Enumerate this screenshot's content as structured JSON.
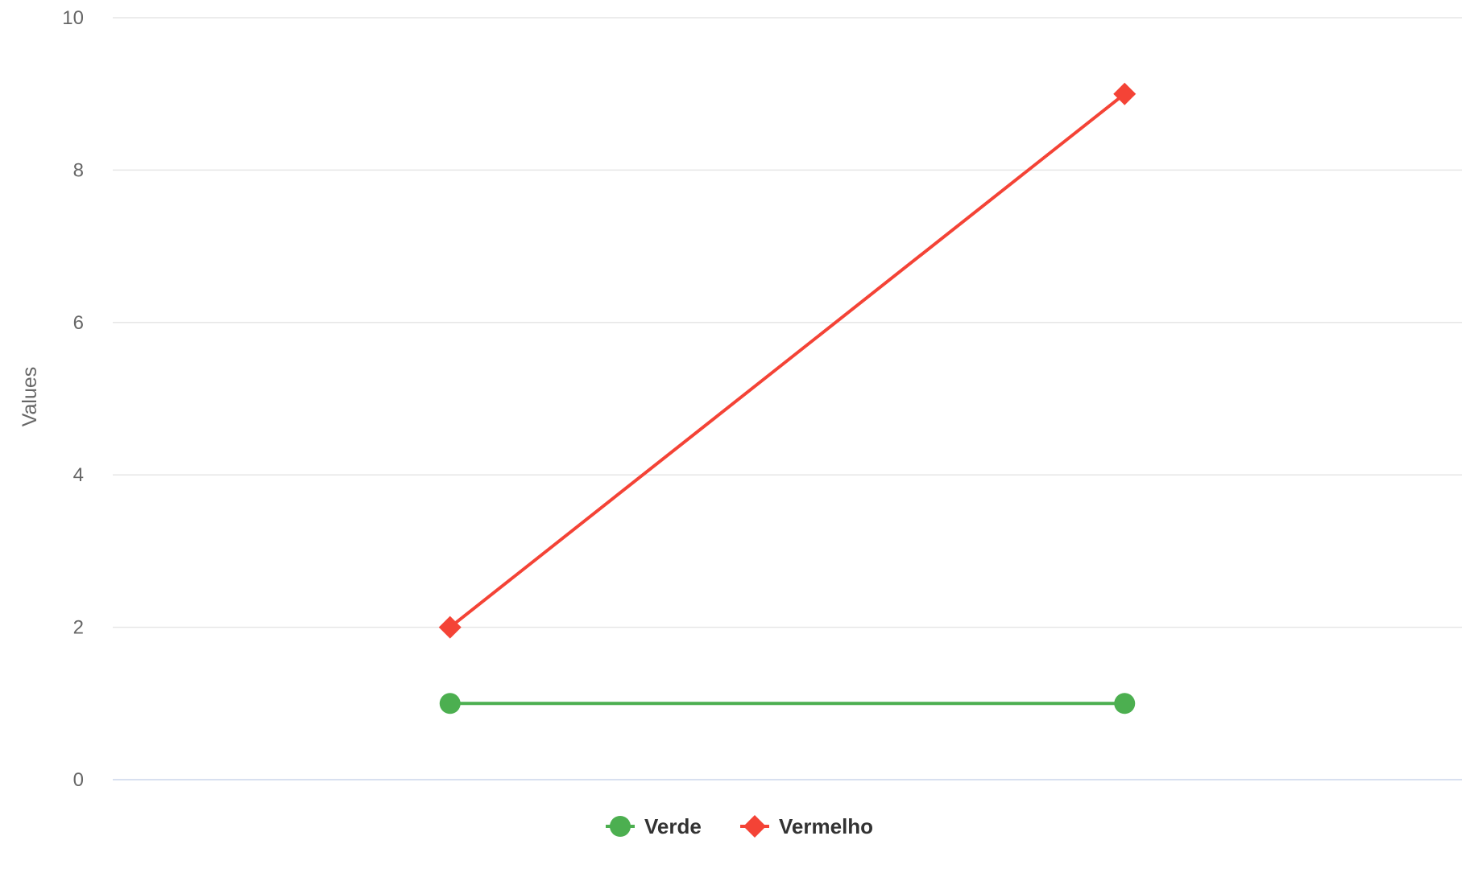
{
  "chart_data": {
    "type": "line",
    "title": "",
    "xlabel": "",
    "ylabel": "Values",
    "ylim": [
      0,
      10
    ],
    "yticks": [
      0,
      2,
      4,
      6,
      8,
      10
    ],
    "x": [
      0,
      1
    ],
    "xlim": [
      -0.5,
      1.5
    ],
    "grid": true,
    "legend_position": "bottom-center",
    "series": [
      {
        "name": "Verde",
        "values": [
          1,
          1
        ],
        "color": "#4caf50",
        "marker": "circle"
      },
      {
        "name": "Vermelho",
        "values": [
          2,
          9
        ],
        "color": "#f44336",
        "marker": "diamond"
      }
    ]
  }
}
